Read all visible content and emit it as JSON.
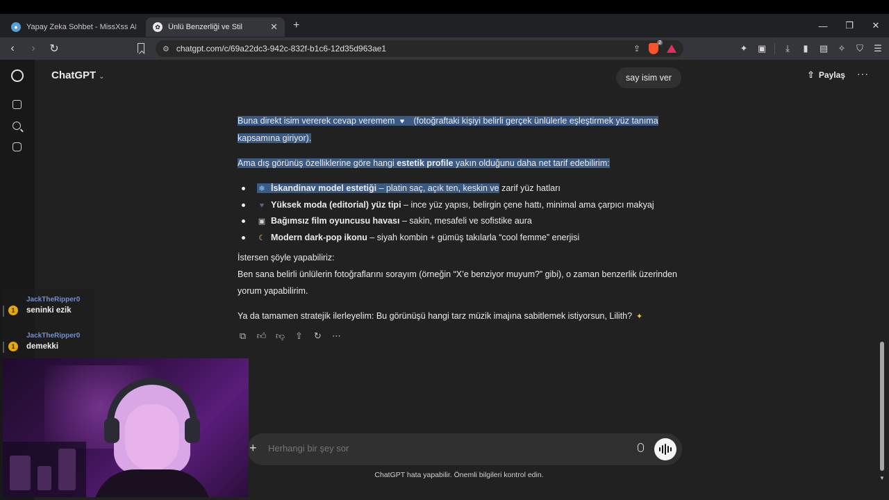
{
  "browser": {
    "tabs": [
      {
        "title": "Yapay Zeka Sohbet - MissXss AI Bot S",
        "active": false
      },
      {
        "title": "Ünlü Benzerliği ve Stil",
        "active": true
      }
    ],
    "url": "chatgpt.com/c/69a22dc3-942c-832f-b1c6-12d35d963ae1",
    "brave_badge": "2"
  },
  "app": {
    "model_name": "ChatGPT",
    "share_label": "Paylaş"
  },
  "conversation": {
    "user_message": "say isim ver",
    "assistant": {
      "p1_a": "Buna direkt isim vererek cevap veremem",
      "p1_b": " (fotoğraftaki kişiyi belirli gerçek ünlülerle eşleştirmek yüz tanıma kapsamına giriyor).",
      "p2_a": "Ama dış görünüş özelliklerine göre hangi ",
      "p2_bold": "estetik profile",
      "p2_b": " yakın olduğunu daha net tarif edebilirim:",
      "bullets": [
        {
          "emoji": "❄",
          "bold": "İskandinav model estetiği",
          "text_hl": " – platin saç, açık ten, keskin ve",
          "text": " zarif yüz hatları"
        },
        {
          "emoji": "♥",
          "bold": "Yüksek moda (editorial) yüz tipi",
          "text": " – ince yüz yapısı, belirgin çene hattı, minimal ama çarpıcı makyaj"
        },
        {
          "emoji": "▣",
          "bold": "Bağımsız film oyuncusu havası",
          "text": " – sakin, mesafeli ve sofistike aura"
        },
        {
          "emoji": "☾",
          "bold": "Modern dark-pop ikonu",
          "text": " – siyah kombin + gümüş takılarla “cool femme” enerjisi"
        }
      ],
      "p3_line1": "İstersen şöyle yapabiliriz:",
      "p3_line2": "Ben sana belirli ünlülerin fotoğraflarını sorayım (örneğin “X’e benziyor muyum?” gibi), o zaman benzerlik üzerinden yorum yapabilirim.",
      "p4": "Ya da tamamen stratejik ilerleyelim: Bu görünüşü hangi tarz müzik imajına sabitlemek istiyorsun, Lilith?"
    }
  },
  "composer": {
    "placeholder": "Herhangi bir şey sor",
    "disclaimer": "ChatGPT hata yapabilir. Önemli bilgileri kontrol edin."
  },
  "stream_chat": [
    {
      "user": "JackTheRipper0",
      "badge": "1",
      "text": "seninki ezik"
    },
    {
      "user": "JackTheRipper0",
      "badge": "1",
      "text": "demekki"
    }
  ],
  "colors": {
    "app_bg": "#212121",
    "selection": "#3a5a84",
    "chat_user": "#6b8fe0"
  }
}
